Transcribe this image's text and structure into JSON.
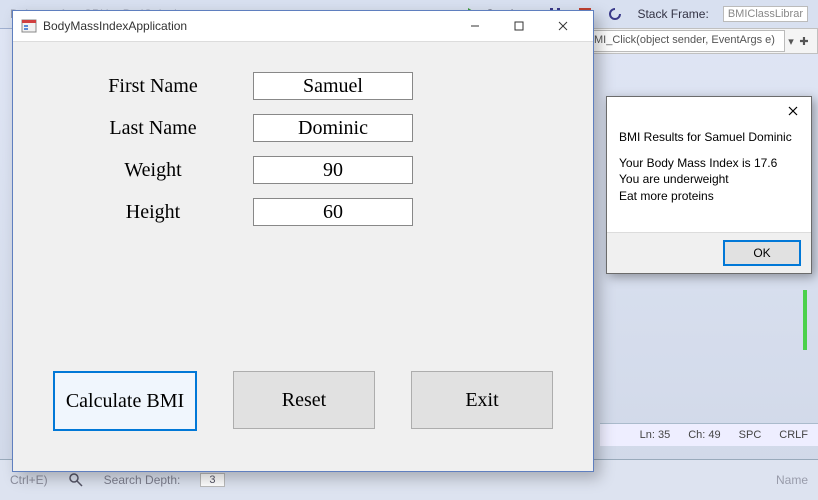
{
  "vs": {
    "continue_label": "Continue",
    "stack_frame_label": "Stack Frame:",
    "stack_frame_value": "BMIClassLibrar",
    "editor_combo": "MI_Click(object sender, EventArgs e)",
    "status": {
      "ln_label": "Ln:",
      "ln": "35",
      "ch_label": "Ch:",
      "ch": "49",
      "spc": "SPC",
      "crlf": "CRLF"
    },
    "bottom": {
      "ctrl_e": "Ctrl+E)",
      "search_depth_label": "Search Depth:",
      "search_depth": "3",
      "name_col": "Name"
    },
    "toolbar_faded": [
      "Debug",
      "Any CPU",
      "BmiCalculator"
    ]
  },
  "winform": {
    "title": "BodyMassIndexApplication",
    "labels": {
      "first_name": "First Name",
      "last_name": "Last Name",
      "weight": "Weight",
      "height": "Height"
    },
    "values": {
      "first_name": "Samuel",
      "last_name": "Dominic",
      "weight": "90",
      "height": "60"
    },
    "buttons": {
      "calculate": "Calculate BMI",
      "reset": "Reset",
      "exit": "Exit"
    }
  },
  "msgbox": {
    "line1": "BMI Results for Samuel Dominic",
    "line2": "Your Body Mass Index is 17.6",
    "line3": "You are underweight",
    "line4": "Eat more proteins",
    "ok": "OK"
  }
}
